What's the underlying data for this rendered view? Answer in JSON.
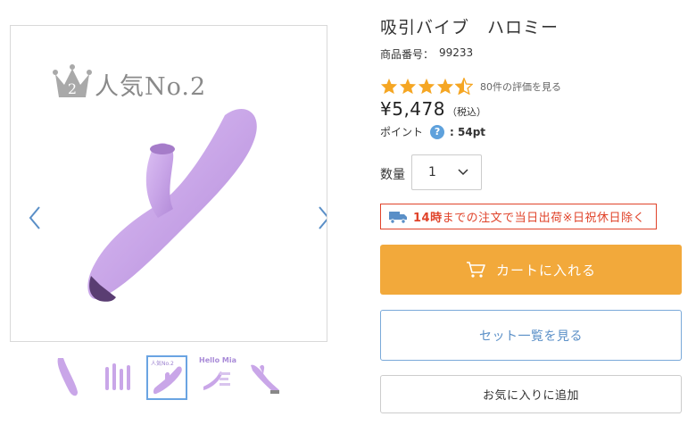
{
  "gallery": {
    "badge_number": "2",
    "badge_text": "人気No.2",
    "thumbnails": [
      {
        "caption": ""
      },
      {
        "caption": ""
      },
      {
        "caption": "人気No.2",
        "active": true
      },
      {
        "caption": "Hello Mia"
      },
      {
        "caption": ""
      }
    ],
    "icons": {
      "prev": "chevron-left-icon",
      "next": "chevron-right-icon"
    }
  },
  "product": {
    "title": "吸引バイブ　ハロミー",
    "sku_label": "商品番号：",
    "sku_value": "99233",
    "rating": 4.5,
    "review_link": "80件の評価を見る",
    "price": "¥5,478",
    "price_tax": "（税込）",
    "points_label": "ポイント",
    "points_help": "?",
    "points_value": ": 54pt"
  },
  "quantity": {
    "label": "数量",
    "value": "1"
  },
  "shipping": {
    "highlight": "14時",
    "text": "までの注文で当日出荷※日祝休日除く",
    "icon": "truck-icon"
  },
  "actions": {
    "cart_label": "カートに入れる",
    "set_label": "セット一覧を見る",
    "favorite_label": "お気に入りに追加"
  },
  "colors": {
    "accent_orange": "#f2a93b",
    "star": "#f5a623",
    "alert_red": "#e0432a",
    "link_blue": "#5a8fc7",
    "product_purple": "#c9a6e8"
  }
}
